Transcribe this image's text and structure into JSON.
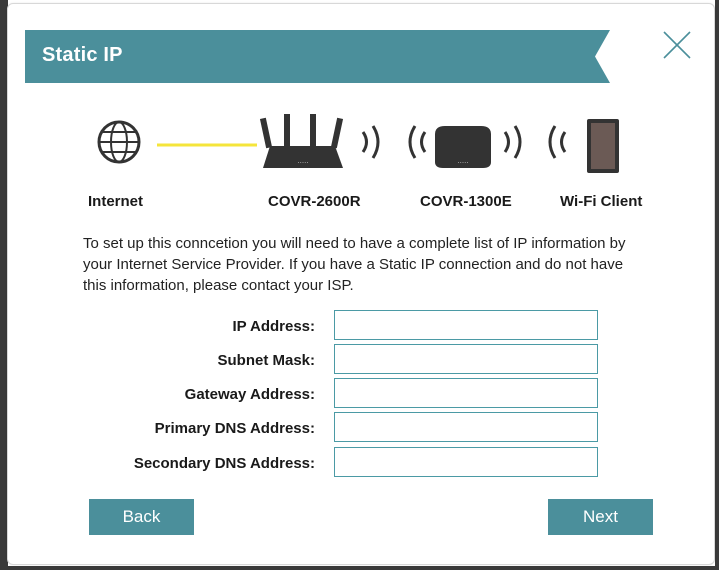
{
  "dialog": {
    "title": "Static IP",
    "accent_color": "#4b8f9b",
    "close_icon": "close-icon"
  },
  "topology": {
    "devices": [
      {
        "label": "Internet",
        "icon": "globe-icon"
      },
      {
        "label": "COVR-2600R",
        "icon": "router-icon"
      },
      {
        "label": "COVR-1300E",
        "icon": "extender-icon"
      },
      {
        "label": "Wi-Fi Client",
        "icon": "tablet-icon"
      }
    ],
    "link_color": "#f5e53b"
  },
  "description": "To set up this conncetion you will need to have a complete list of IP information by your Internet Service Provider. If you have a Static IP connection and do not have this information, please contact your ISP.",
  "form": {
    "fields": [
      {
        "label": "IP Address:",
        "value": ""
      },
      {
        "label": "Subnet Mask:",
        "value": ""
      },
      {
        "label": "Gateway Address:",
        "value": ""
      },
      {
        "label": "Primary DNS Address:",
        "value": ""
      },
      {
        "label": "Secondary DNS Address:",
        "value": ""
      }
    ]
  },
  "buttons": {
    "back": "Back",
    "next": "Next"
  }
}
